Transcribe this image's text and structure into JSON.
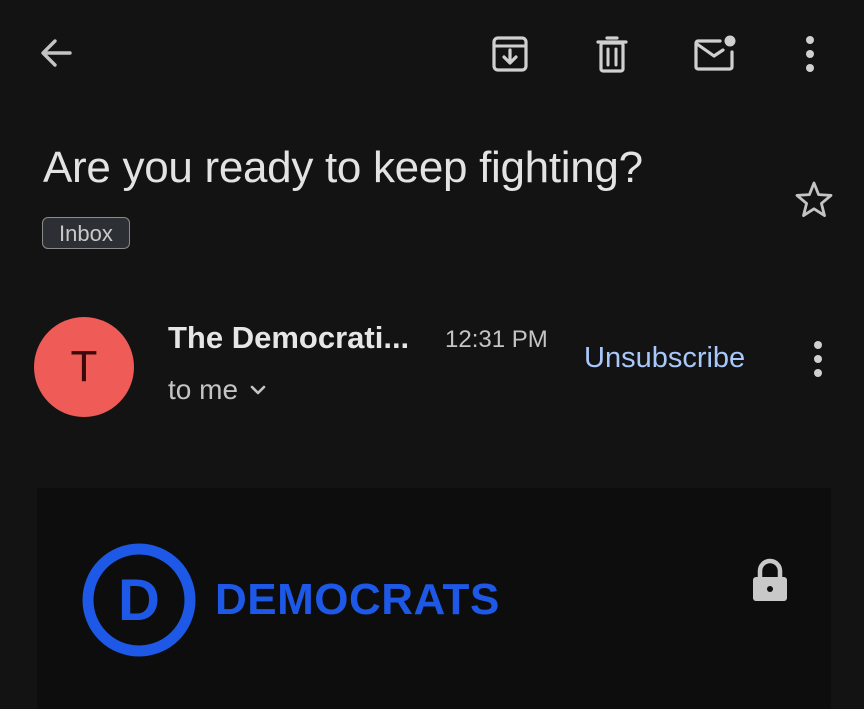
{
  "toolbar": {
    "icons": [
      "back-arrow-icon",
      "archive-icon",
      "trash-icon",
      "mark-unread-icon",
      "more-vert-icon"
    ]
  },
  "email": {
    "subject": "Are you ready to keep fighting?",
    "label": "Inbox",
    "starred": false,
    "sender": {
      "avatar_initial": "T",
      "avatar_color": "#ef5b57",
      "name": "The Democrati...",
      "time": "12:31 PM",
      "recipient": "to me",
      "unsubscribe_label": "Unsubscribe"
    },
    "body": {
      "logo_letter": "D",
      "logo_text": "DEMOCRATS",
      "brand_color": "#1e58e6"
    }
  },
  "colors": {
    "background": "#131313",
    "link": "#a8c7fa"
  }
}
